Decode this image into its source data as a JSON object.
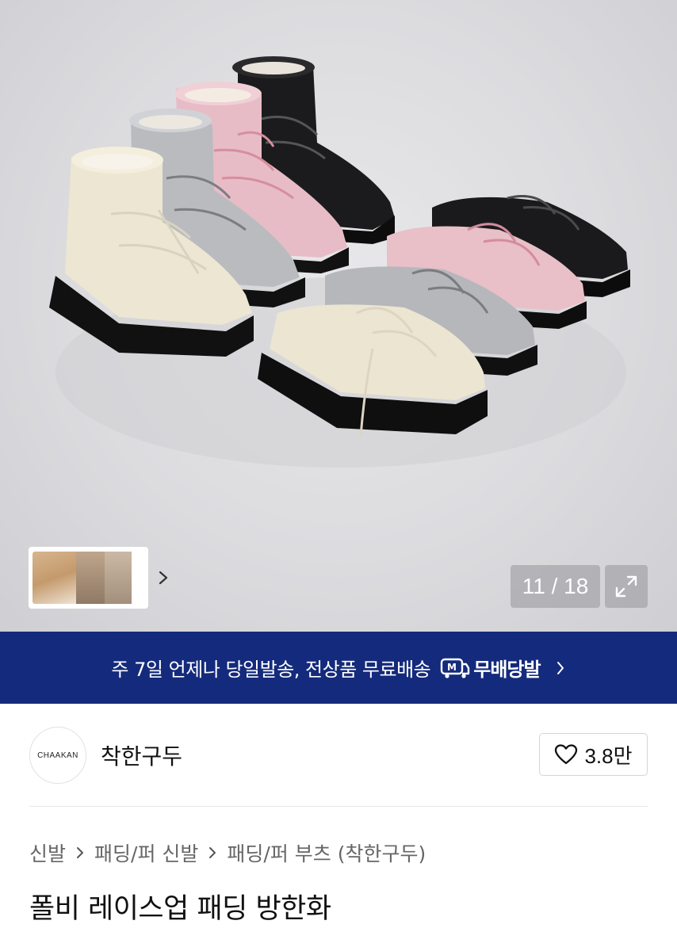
{
  "gallery": {
    "current": "11",
    "total": "18",
    "counter_text": "11 / 18"
  },
  "banner": {
    "text": "주 7일 언제나 당일발송, 전상품 무료배송",
    "logo_text": "무배당발",
    "background": "#142a7c"
  },
  "brand": {
    "logo_text": "CHAAKAN",
    "name": "착한구두",
    "likes": "3.8만"
  },
  "breadcrumb": [
    "신발",
    "패딩/퍼 신발",
    "패딩/퍼 부츠 (착한구두)"
  ],
  "product": {
    "title": "폴비 레이스업 패딩 방한화"
  },
  "icons": {
    "thumb_next": "chevron-right-icon",
    "expand": "expand-icon",
    "like": "heart-icon",
    "banner_logo": "delivery-m-icon"
  }
}
